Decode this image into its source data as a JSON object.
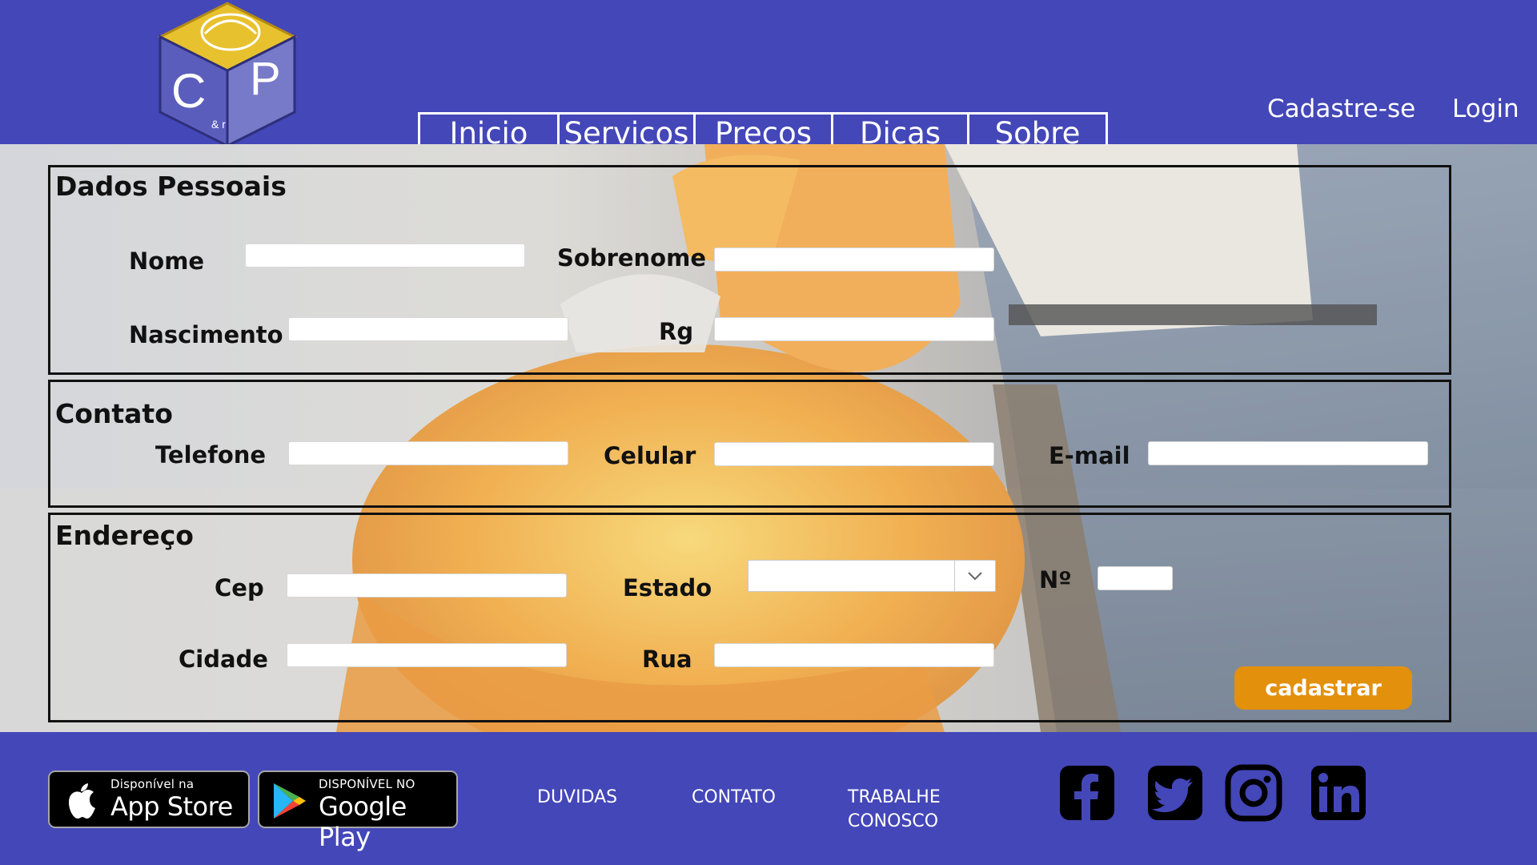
{
  "header": {
    "logo_letters": [
      "C",
      "P"
    ],
    "nav": [
      "Inicio",
      "Servicos",
      "Precos",
      "Dicas",
      "Sobre"
    ],
    "signup_label": "Cadastre-se",
    "login_label": "Login"
  },
  "form": {
    "personal": {
      "title": "Dados Pessoais",
      "nome_label": "Nome",
      "sobrenome_label": "Sobrenome",
      "nascimento_label": "Nascimento",
      "rg_label": "Rg"
    },
    "contact": {
      "title": "Contato",
      "telefone_label": "Telefone",
      "celular_label": "Celular",
      "email_label": "E-mail"
    },
    "address": {
      "title": "Endereço",
      "cep_label": "Cep",
      "estado_label": "Estado",
      "numero_label": "Nº",
      "cidade_label": "Cidade",
      "rua_label": "Rua",
      "estado_value": ""
    },
    "submit_label": "cadastrar"
  },
  "footer": {
    "appstore": {
      "small": "Disponível na",
      "big": "App Store"
    },
    "googleplay": {
      "small": "DISPONÍVEL NO",
      "big": "Google Play"
    },
    "links": [
      "DUVIDAS",
      "CONTATO",
      "TRABALHE\nCONOSCO"
    ],
    "social_icons": [
      "facebook-icon",
      "twitter-icon",
      "instagram-icon",
      "linkedin-icon"
    ]
  },
  "colors": {
    "brand_blue": "#4447b8",
    "button_orange": "#e3900c",
    "logo_yellow": "#e8c12e",
    "logo_purple": "#5b5dbd"
  }
}
